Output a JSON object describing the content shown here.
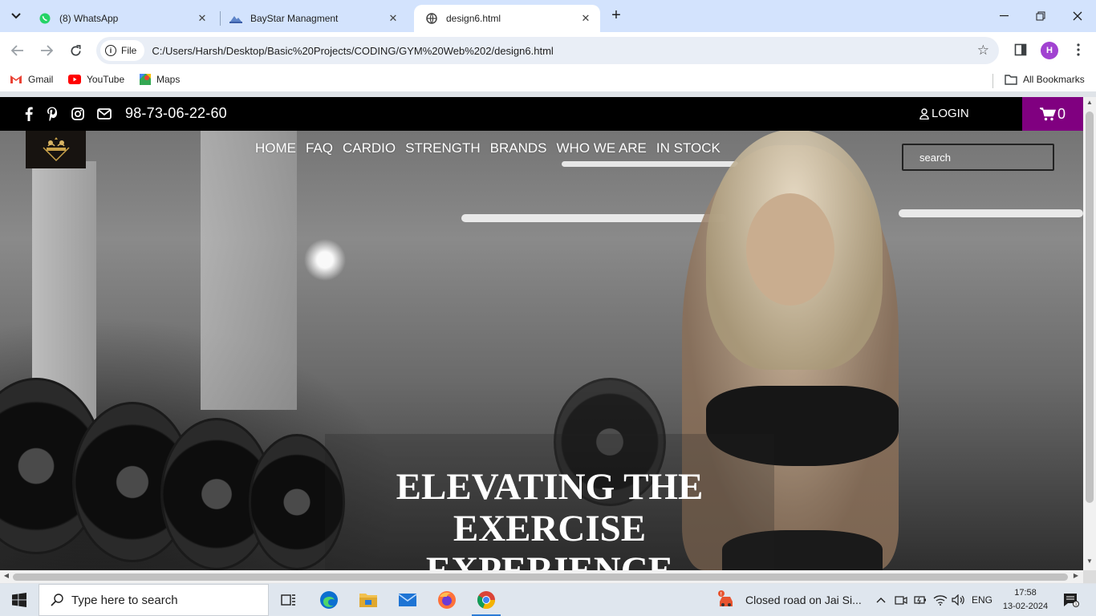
{
  "browser": {
    "tabs": [
      {
        "title": "(8) WhatsApp",
        "icon": "whatsapp-icon"
      },
      {
        "title": "BayStar Managment",
        "icon": "baystar-icon"
      },
      {
        "title": "design6.html",
        "icon": "globe-icon"
      }
    ],
    "address": {
      "chip_label": "File",
      "url": "C:/Users/Harsh/Desktop/Basic%20Projects/CODING/GYM%20Web%202/design6.html"
    },
    "profile_initial": "H",
    "bookmarks": [
      {
        "label": "Gmail",
        "icon": "gmail-icon"
      },
      {
        "label": "YouTube",
        "icon": "youtube-icon"
      },
      {
        "label": "Maps",
        "icon": "maps-icon"
      }
    ],
    "all_bookmarks_label": "All Bookmarks"
  },
  "site": {
    "phone": "98-73-06-22-60",
    "login_label": "LOGIN",
    "cart_count": "0",
    "nav": [
      "HOME",
      "FAQ",
      "CARDIO",
      "STRENGTH",
      "BRANDS",
      "WHO WE ARE",
      "IN STOCK"
    ],
    "search_placeholder": "search",
    "headline_line1": "ELEVATING THE",
    "headline_line2": "EXERCISE EXPERIENCE",
    "colors": {
      "topbar": "#000000",
      "cart": "#800080",
      "text": "#ffffff"
    }
  },
  "taskbar": {
    "search_placeholder": "Type here to search",
    "news": "Closed road on Jai Si...",
    "language": "ENG",
    "time": "17:58",
    "date": "13-02-2024"
  }
}
